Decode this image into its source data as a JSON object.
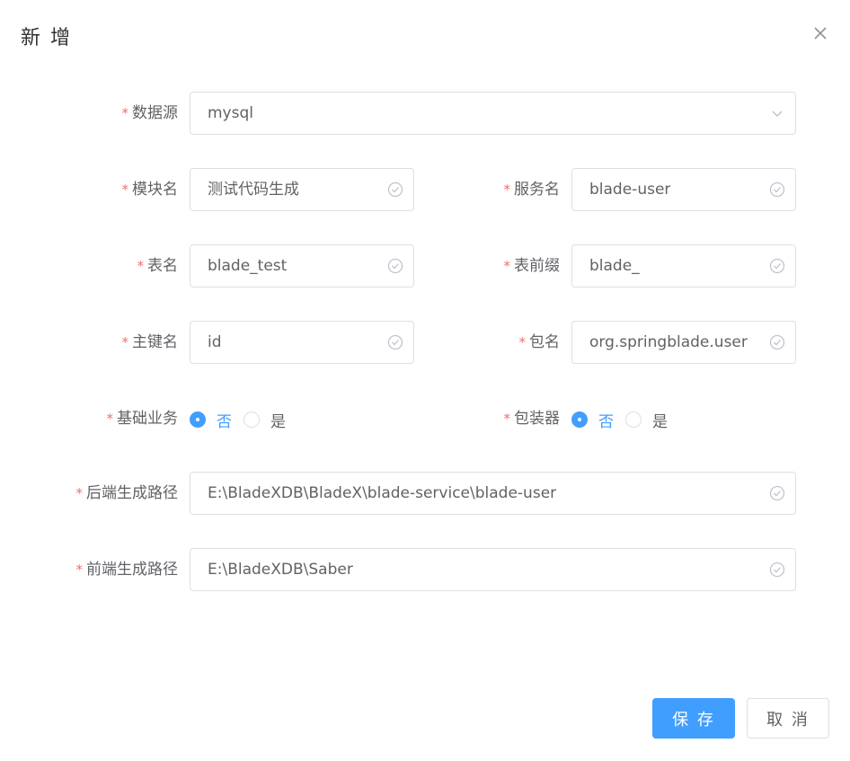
{
  "dialog": {
    "title": "新 增"
  },
  "form": {
    "required_mark": "*",
    "datasource": {
      "label": "数据源",
      "value": "mysql"
    },
    "module_name": {
      "label": "模块名",
      "value": "测试代码生成"
    },
    "service_name": {
      "label": "服务名",
      "value": "blade-user"
    },
    "table_name": {
      "label": "表名",
      "value": "blade_test"
    },
    "table_prefix": {
      "label": "表前缀",
      "value": "blade_"
    },
    "primary_key": {
      "label": "主键名",
      "value": "id"
    },
    "package_name": {
      "label": "包名",
      "value": "org.springblade.user"
    },
    "base_business": {
      "label": "基础业务",
      "options": [
        "否",
        "是"
      ],
      "selected": "否"
    },
    "wrapper": {
      "label": "包装器",
      "options": [
        "否",
        "是"
      ],
      "selected": "否"
    },
    "backend_path": {
      "label": "后端生成路径",
      "value": "E:\\BladeXDB\\BladeX\\blade-service\\blade-user"
    },
    "frontend_path": {
      "label": "前端生成路径",
      "value": "E:\\BladeXDB\\Saber"
    }
  },
  "footer": {
    "save_label": "保 存",
    "cancel_label": "取 消"
  },
  "colors": {
    "primary": "#409eff",
    "required": "#f56c6c",
    "border": "#dcdfe6",
    "text": "#606266"
  },
  "icons": {
    "close": "close-icon",
    "select_arrow": "chevron-down-icon",
    "validate": "check-circle-icon"
  }
}
